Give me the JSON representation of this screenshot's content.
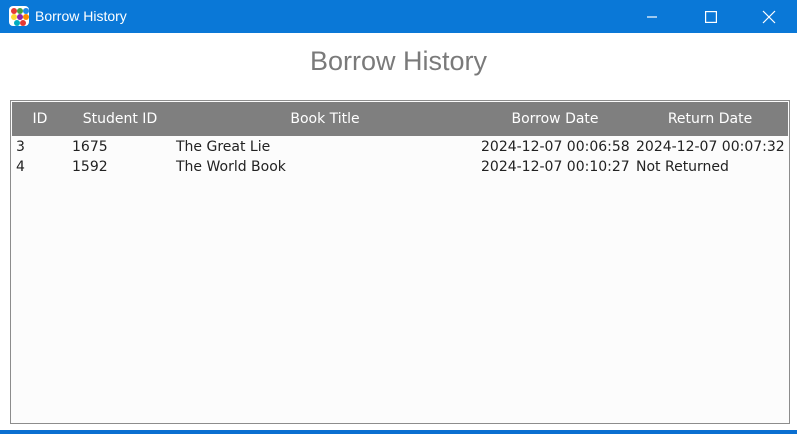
{
  "window": {
    "title": "Borrow History"
  },
  "page": {
    "heading": "Borrow History"
  },
  "table": {
    "columns": [
      "ID",
      "Student ID",
      "Book Title",
      "Borrow Date",
      "Return Date"
    ],
    "rows": [
      [
        "3",
        "1675",
        "The Great Lie",
        "2024-12-07 00:06:58",
        "2024-12-07 00:07:32"
      ],
      [
        "4",
        "1592",
        "The World Book",
        "2024-12-07 00:10:27",
        "Not Returned"
      ]
    ]
  },
  "colors": {
    "titlebar": "#0a78d7",
    "header": "#7f7f7f"
  }
}
